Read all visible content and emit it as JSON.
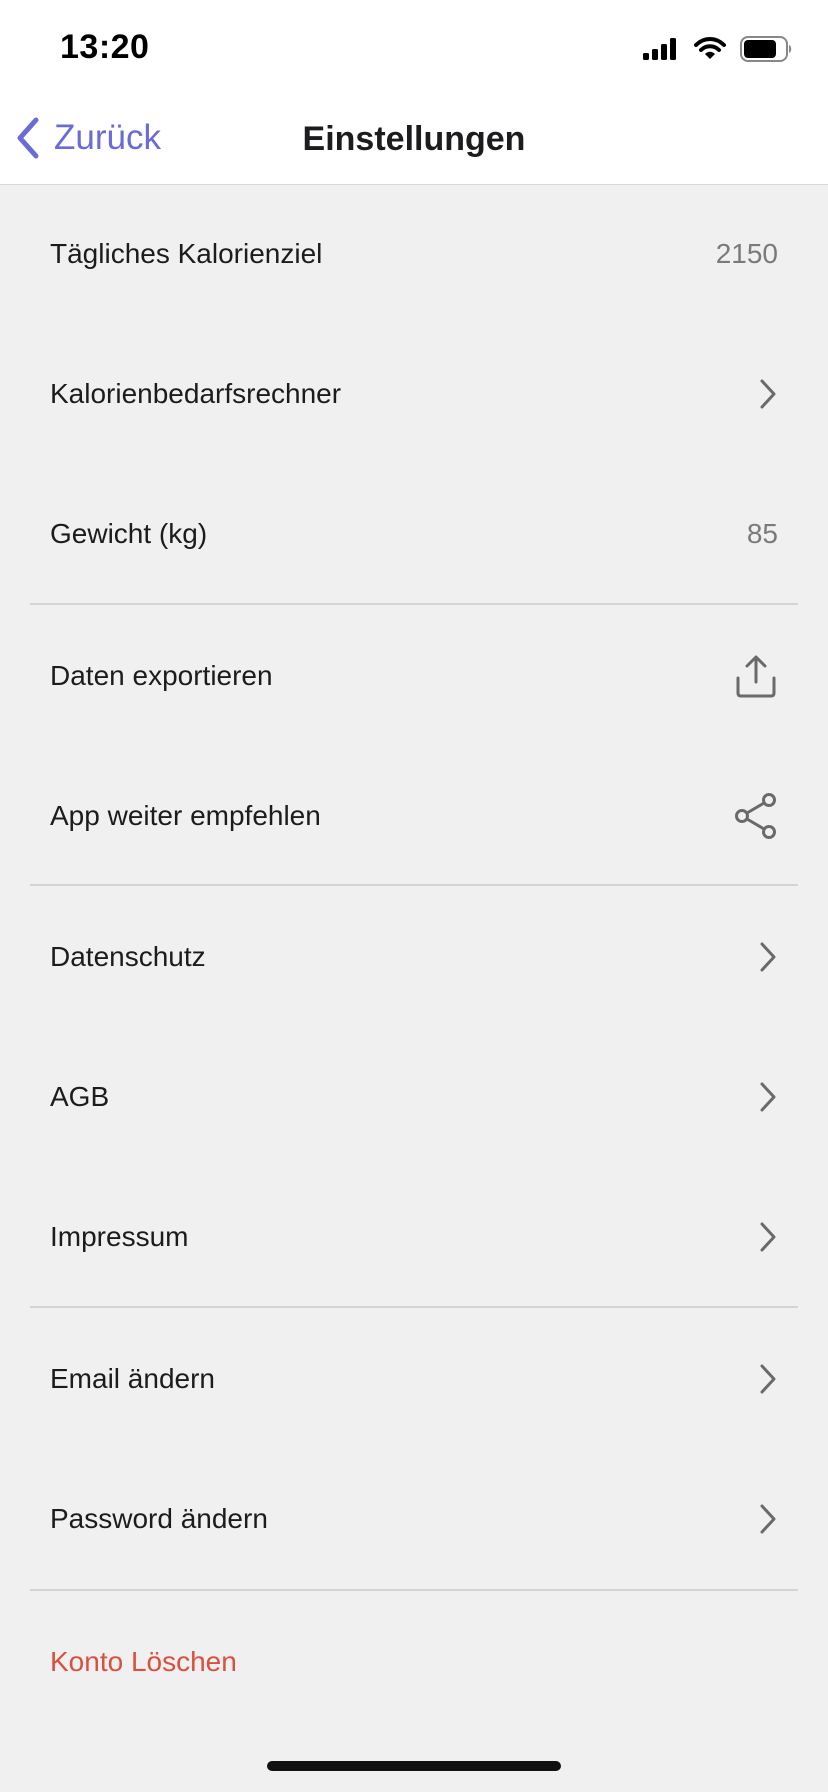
{
  "status_bar": {
    "time": "13:20"
  },
  "nav": {
    "back_label": "Zurück",
    "title": "Einstellungen"
  },
  "settings": {
    "daily_calorie_goal": {
      "label": "Tägliches Kalorienziel",
      "value": "2150"
    },
    "calorie_calculator": {
      "label": "Kalorienbedarfsrechner"
    },
    "weight": {
      "label": "Gewicht (kg)",
      "value": "85"
    },
    "export_data": {
      "label": "Daten exportieren"
    },
    "recommend_app": {
      "label": "App weiter empfehlen"
    },
    "privacy": {
      "label": "Datenschutz"
    },
    "terms": {
      "label": "AGB"
    },
    "imprint": {
      "label": "Impressum"
    },
    "change_email": {
      "label": "Email ändern"
    },
    "change_password": {
      "label": "Password ändern"
    },
    "delete_account": {
      "label": "Konto Löschen"
    }
  },
  "colors": {
    "accent": "#6b6bd6",
    "destructive": "#d9503f",
    "background": "#f0f0f0",
    "text": "#1c1c1e",
    "secondary_text": "#7a7a7a"
  },
  "icons": {
    "back": "chevron-left-icon",
    "disclosure": "chevron-right-icon",
    "export": "share-upload-icon",
    "share": "share-nodes-icon",
    "signal": "cellular-signal-icon",
    "wifi": "wifi-icon",
    "battery": "battery-icon"
  }
}
